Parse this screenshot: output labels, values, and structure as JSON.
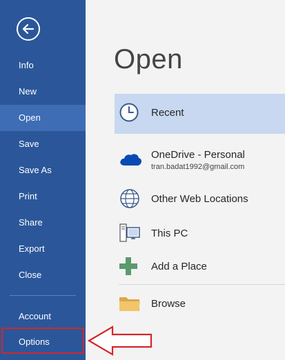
{
  "sidebar": {
    "back_icon": "back-arrow-icon",
    "items": [
      {
        "label": "Info"
      },
      {
        "label": "New"
      },
      {
        "label": "Open",
        "active": true
      },
      {
        "label": "Save"
      },
      {
        "label": "Save As"
      },
      {
        "label": "Print"
      },
      {
        "label": "Share"
      },
      {
        "label": "Export"
      },
      {
        "label": "Close"
      },
      {
        "label": "Account"
      },
      {
        "label": "Options"
      }
    ],
    "background_color": "#2b579a",
    "active_color": "#3e6db5"
  },
  "main": {
    "title": "Open",
    "locations": [
      {
        "label": "Recent",
        "icon": "clock-icon",
        "selected": true
      },
      {
        "label": "OneDrive - Personal",
        "sublabel": "tran.badat1992@gmail.com",
        "icon": "onedrive-cloud-icon"
      },
      {
        "label": "Other Web Locations",
        "icon": "globe-icon"
      },
      {
        "label": "This PC",
        "icon": "computer-icon"
      },
      {
        "label": "Add a Place",
        "icon": "plus-icon"
      },
      {
        "label": "Browse",
        "icon": "folder-icon"
      }
    ],
    "selected_color": "#c7d8f0"
  },
  "annotation": {
    "highlight_color": "#d4262a",
    "arrow_icon": "left-arrow-annotation-icon"
  }
}
